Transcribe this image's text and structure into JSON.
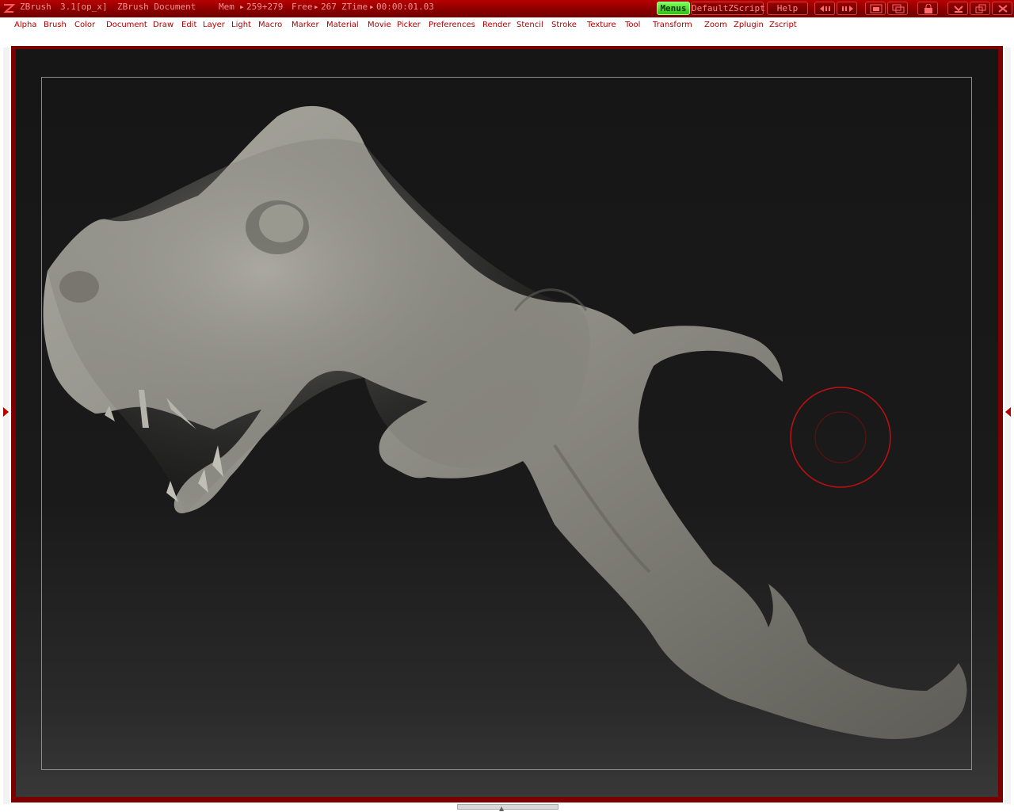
{
  "titlebar": {
    "app_name": "ZBrush",
    "version": "3.1[op_x]",
    "document": "ZBrush Document",
    "mem_label": "Mem",
    "mem_value": "259+279",
    "free_label": "Free",
    "free_value": "267",
    "ztime_label": "ZTime",
    "ztime_value": "00:00:01.03",
    "menus_button": "Menus",
    "script_button": "DefaultZScript",
    "help_button": "Help"
  },
  "menubar": {
    "items": [
      "Alpha",
      "Brush",
      "Color",
      "Document",
      "Draw",
      "Edit",
      "Layer",
      "Light",
      "Macro",
      "Marker",
      "Material",
      "Movie",
      "Picker",
      "Preferences",
      "Render",
      "Stencil",
      "Stroke",
      "Texture",
      "Tool",
      "Transform",
      "Zoom",
      "Zplugin",
      "Zscript"
    ]
  },
  "icons": {
    "logo": "zbrush-logo-icon",
    "brush_cursor": "brush-cursor-icon"
  },
  "colors": {
    "accent": "#b30000",
    "menus_active": "#4fe02a",
    "canvas_bg": "#1a1a1a"
  }
}
